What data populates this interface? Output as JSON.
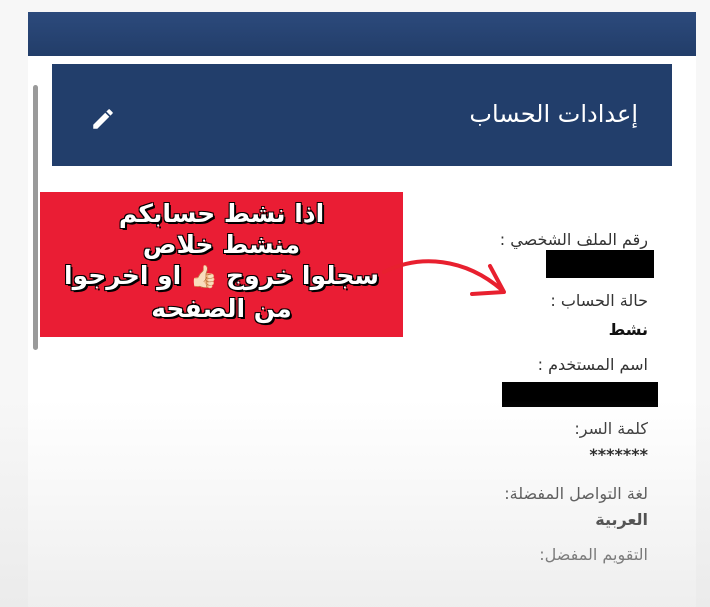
{
  "panel": {
    "title": "إعدادات الحساب",
    "edit_icon": "pencil-icon"
  },
  "fields": {
    "profile_number_label": "رقم الملف الشخصي :",
    "account_status_label": "حالة الحساب :",
    "account_status_value": "نشط",
    "username_label": "اسم المستخدم :",
    "password_label": "كلمة السر:",
    "password_value": "*******",
    "language_label": "لغة التواصل المفضلة:",
    "language_value": "العربية",
    "calendar_label": "التقويم المفضل:"
  },
  "overlay": {
    "line1": "اذا نشط حسابكم",
    "line2": "منشط خلاص",
    "line3_before": "سجلوا خروج",
    "line3_emoji": "👍🏻",
    "line3_after": "او اخرجوا",
    "line4": "من الصفحه",
    "color": "#ea1d34"
  },
  "colors": {
    "header_blue": "#223e6b",
    "top_bar_blue": "#2c4a7c",
    "redaction": "#000000"
  }
}
